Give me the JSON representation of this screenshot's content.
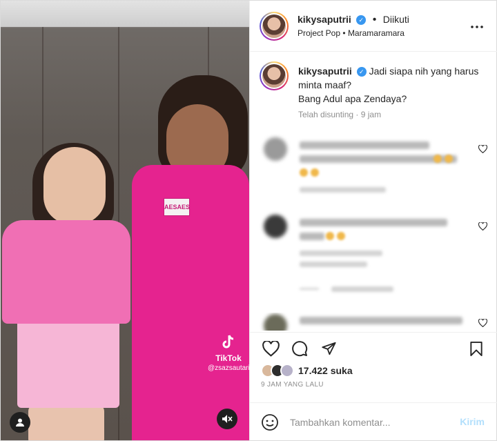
{
  "media": {
    "badge_text": "AESAES",
    "tiktok": {
      "icon": "tiktok-note-icon",
      "brand": "TikTok",
      "handle": "@zsazsautari"
    },
    "user_icon": "user-icon",
    "mute_icon": "muted-speaker-icon"
  },
  "header": {
    "username": "kikysaputrii",
    "follow_status": "Diikuti",
    "subtitle_left": "Project Pop",
    "subtitle_right": "Maramaramara",
    "more_icon": "more-options-icon"
  },
  "caption": {
    "username": "kikysaputrii",
    "line1": "Jadi siapa nih yang harus minta maaf?",
    "line2": "Bang Adul apa Zendaya?",
    "meta": "Telah disunting · 9 jam"
  },
  "actions": {
    "likes": "17.422 suka",
    "time_ago": "9 JAM YANG LALU"
  },
  "comment_box": {
    "placeholder": "Tambahkan komentar...",
    "post_label": "Kirim"
  },
  "colors": {
    "verified": "#3897f0",
    "post_disabled": "#b2dffc",
    "muted_text": "#8e8e8e"
  }
}
